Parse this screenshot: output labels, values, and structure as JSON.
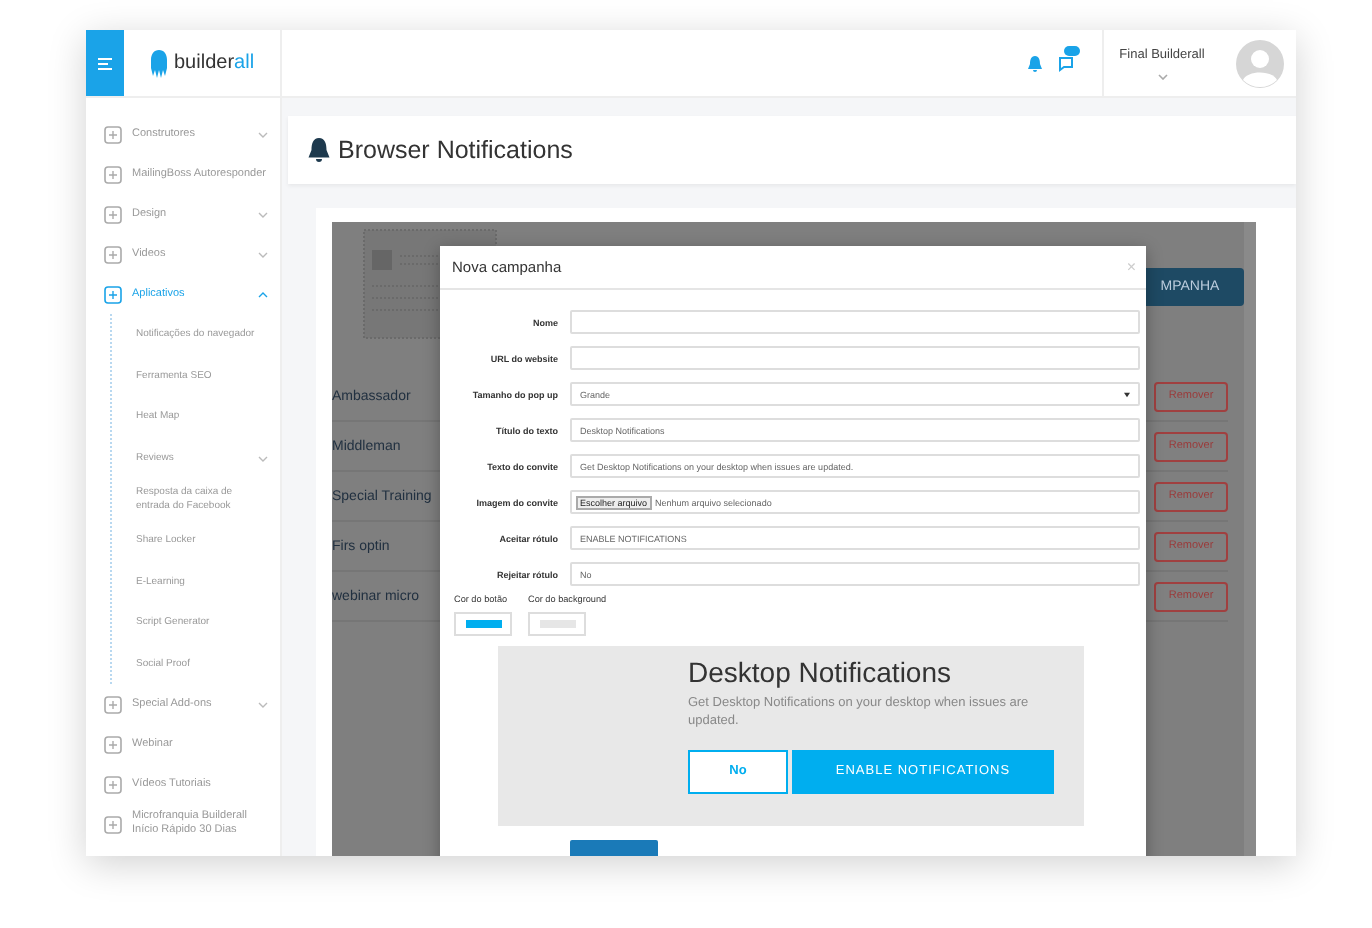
{
  "logo": {
    "part_1": "builder",
    "part_2": "all"
  },
  "header": {
    "user": "Final Builderall"
  },
  "sidebar": {
    "items": [
      {
        "label": "Construtores",
        "expandable": true,
        "expanded": false,
        "selected": false
      },
      {
        "label": "MailingBoss Autoresponder",
        "selected": false
      },
      {
        "label": "Design",
        "expandable": true,
        "expanded": false,
        "selected": false
      },
      {
        "label": "Videos",
        "expandable": true,
        "expanded": false,
        "selected": false
      },
      {
        "label": "Aplicativos",
        "expandable": true,
        "expanded": true,
        "selected": true,
        "children": [
          {
            "label": "Notificações do navegador"
          },
          {
            "label": "Ferramenta SEO"
          },
          {
            "label": "Heat Map"
          },
          {
            "label": "Reviews",
            "expandable": true,
            "expanded": false
          },
          {
            "label": "Resposta da caixa de entrada do Facebook"
          },
          {
            "label": "Share Locker"
          },
          {
            "label": "E-Learning"
          },
          {
            "label": "Script Generator"
          },
          {
            "label": "Social Proof"
          }
        ]
      },
      {
        "label": "Special Add-ons",
        "expandable": true,
        "expanded": false,
        "selected": false
      },
      {
        "label": "Webinar",
        "selected": false
      },
      {
        "label": "Vídeos Tutoriais",
        "selected": false
      },
      {
        "label": "Microfranquia Builderall Início Rápido 30 Dias",
        "selected": false
      }
    ]
  },
  "page_title": "Browser Notifications",
  "campaign_list": {
    "button": "MPANHA",
    "rows": [
      {
        "name": "Ambassador",
        "action": "Remover"
      },
      {
        "name": "Middleman",
        "action": "Remover"
      },
      {
        "name": "Special Training",
        "action": "Remover"
      },
      {
        "name": "Firs optin",
        "action": "Remover"
      },
      {
        "name": "webinar micro",
        "action": "Remover"
      }
    ]
  },
  "modal": {
    "title": "Nova campanha",
    "close": "×",
    "fields": [
      {
        "kind": "text",
        "label": "Nome"
      },
      {
        "kind": "text",
        "label": "URL do website"
      },
      {
        "kind": "select",
        "label": "Tamanho do pop up",
        "value": "Grande"
      },
      {
        "kind": "text",
        "label": "Título do texto",
        "value": "Desktop Notifications"
      },
      {
        "kind": "text",
        "label": "Texto do convite",
        "value": "Get Desktop Notifications on your desktop when issues are updated."
      },
      {
        "kind": "file",
        "label": "Imagem do convite",
        "button": "Escolher arquivo",
        "value": "Nenhum arquivo selecionado"
      },
      {
        "kind": "text",
        "label": "Aceitar rótulo",
        "value": "ENABLE NOTIFICATIONS"
      },
      {
        "kind": "text",
        "label": "Rejeitar rótulo",
        "value": "No"
      }
    ],
    "colors": [
      {
        "label": "Cor do botão",
        "color": "#00aeef"
      },
      {
        "label": "Cor do background",
        "color": "#e6e6e6"
      }
    ],
    "preview": {
      "title": "Desktop Notifications",
      "text": "Get Desktop Notifications on your desktop when issues are updated.",
      "reject": "No",
      "accept": "ENABLE NOTIFICATIONS"
    }
  }
}
